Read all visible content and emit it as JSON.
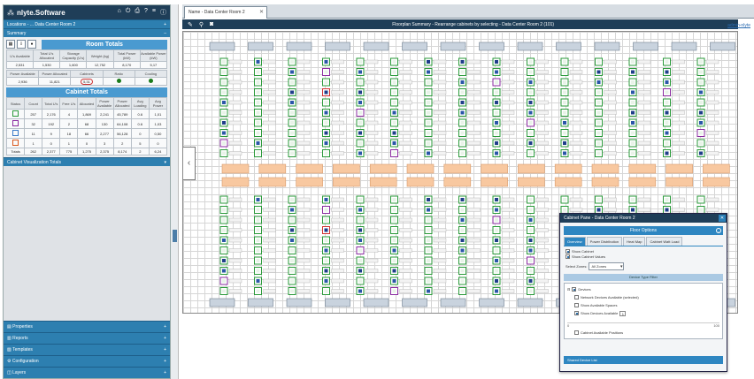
{
  "app": {
    "title": "nlyte.Software",
    "header_icons": [
      "home-icon",
      "power-icon",
      "print-icon",
      "help-icon",
      "menu-icon",
      "info-icon"
    ]
  },
  "sidebar": {
    "location": "Locations - ... Data Center Room 2",
    "summary_title": "Summary",
    "room_totals_title": "Room Totals",
    "room_totals_headers": [
      "U's Available",
      "Total U's Allocated",
      "Storage Capacity (U's)",
      "Weight (kg)",
      "Total Power (kW)",
      "Available Power (kW)"
    ],
    "room_totals_values": [
      "2,531",
      "1,530",
      "1,600",
      "12,752",
      "8,170",
      "5,17"
    ],
    "room_totals_headers2": [
      "Power Available",
      "Power Allocated",
      "Cabinets",
      "Ratio",
      "Cooling"
    ],
    "room_totals_values2": [
      "2,936",
      "11,821",
      "5,31",
      "",
      ""
    ],
    "cabinet_totals_title": "Cabinet Totals",
    "cabinet_headers": [
      "Status",
      "Count",
      "Total U's",
      "Free U's",
      "Allocated",
      "Power Available",
      "Power Allocated",
      "Avg Loading",
      "Avg Power"
    ],
    "cabinet_rows": [
      {
        "swatch": "#2a9a3a",
        "cells": [
          "257",
          "2,176",
          "4",
          "1,869",
          "2,241",
          "45,789",
          "0.6",
          "1,01"
        ]
      },
      {
        "swatch": "#8a2aa0",
        "cells": [
          "32",
          "192",
          "2",
          "68",
          "130",
          "64,108",
          "0.6",
          "1,03"
        ]
      },
      {
        "swatch": "#3a7ac8",
        "cells": [
          "11",
          "9",
          "18",
          "66",
          "2,277",
          "56,128",
          "0",
          "0,50"
        ]
      },
      {
        "swatch": "#d9581e",
        "cells": [
          "1",
          "0",
          "1",
          "0",
          "3",
          "2",
          "5",
          "0"
        ]
      }
    ],
    "totals_row": [
      "Totals",
      "262",
      "2,377",
      "775",
      "1,275",
      "2,375",
      "8,174",
      "2",
      "6,24"
    ],
    "cabinet_section": "Cabinet Visualization Totals",
    "bottom_sections": [
      "Properties",
      "Reports",
      "Templates",
      "Configuration",
      "Layers"
    ]
  },
  "main": {
    "tab_label": "Name - Data Center Room 2",
    "toolbar_caption": "Floorplan Summary - Rearrange cabinets by selecting - Data Center Room 2 (101)",
    "user_link": "admin-nlyte"
  },
  "floorplan": {
    "row_label": "A",
    "top_rows": 2,
    "cabinet_cols": 15,
    "cabinet_rows_per_block": 10,
    "cooling_units": 14
  },
  "dialog": {
    "title": "Cabinet Pane - Data Center Room 2",
    "subtitle": "Floor Options",
    "tabs": [
      "Overview",
      "Power Distribution",
      "Heat Map",
      "Cabinet Watt Load"
    ],
    "checkbox_1": "Show Cabinet",
    "checkbox_2": "Show Cabinet Values",
    "select_label": "Select Zones:",
    "select_value": "All Zones",
    "group_title": "Device Type Filter",
    "tree_root": "Devices",
    "tree_items": [
      "Network Devices Available (selected)",
      "Show Available Spaces",
      "Show Devices Available",
      "Cabinet Available Positions"
    ],
    "tree_value": "1",
    "scroll_left": "0",
    "scroll_right": "100",
    "footer": "Shared Device List"
  }
}
